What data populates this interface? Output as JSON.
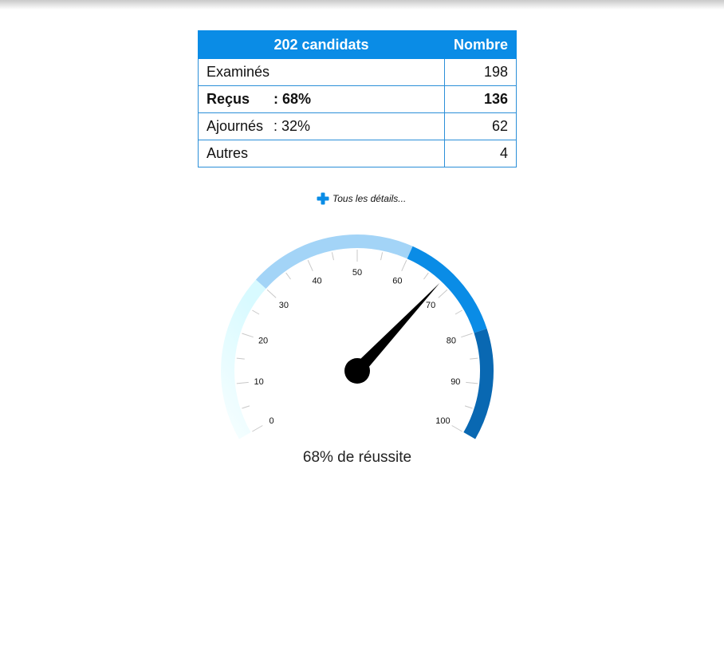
{
  "table": {
    "header_label": "202 candidats",
    "header_count": "Nombre",
    "rows": [
      {
        "label": "Examinés",
        "pct": "",
        "count": "198",
        "bold": false
      },
      {
        "label": "Reçus",
        "pct": ": 68%",
        "count": "136",
        "bold": true
      },
      {
        "label": "Ajournés",
        "pct": ": 32%",
        "count": "62",
        "bold": false
      },
      {
        "label": "Autres",
        "pct": "",
        "count": "4",
        "bold": false
      }
    ]
  },
  "details_link": {
    "label": "Tous les détails...",
    "icon": "plus-icon"
  },
  "gauge": {
    "value": 68,
    "min": 0,
    "max": 100,
    "tick_labels": [
      "0",
      "10",
      "20",
      "30",
      "40",
      "50",
      "60",
      "70",
      "80",
      "90",
      "100"
    ],
    "caption": "68% de réussite",
    "bands": [
      {
        "from": 0,
        "to": 30,
        "color": "#d8faff",
        "fade_to": "#f4feff"
      },
      {
        "from": 30,
        "to": 60,
        "color": "#a3d4f7"
      },
      {
        "from": 60,
        "to": 80,
        "color": "#0a8ce6"
      },
      {
        "from": 80,
        "to": 100,
        "color": "#0968b2"
      }
    ],
    "needle_color": "#000000"
  }
}
